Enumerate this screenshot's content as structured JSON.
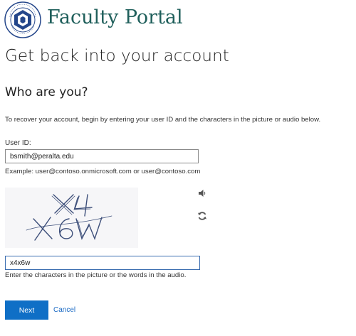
{
  "header": {
    "seal_text": "PERALTA COMMUNITY COLLEGE DISTRICT",
    "portal_title": "Faculty Portal"
  },
  "page": {
    "heading": "Get back into your account",
    "subheading": "Who are you?",
    "instructions": "To recover your account, begin by entering your user ID and the characters in the picture or audio below."
  },
  "form": {
    "userid_label": "User ID:",
    "userid_value": "bsmith@peralta.edu",
    "example_text": "Example: user@contoso.onmicrosoft.com or user@contoso.com",
    "captcha_image_text": "X4 X6W",
    "captcha_value": "x4x6w",
    "captcha_hint": "Enter the characters in the picture or the words in the audio."
  },
  "icons": {
    "audio": "speaker-icon",
    "refresh": "refresh-icon"
  },
  "actions": {
    "next_label": "Next",
    "cancel_label": "Cancel"
  },
  "colors": {
    "brand_teal": "#1f5f5b",
    "primary_button": "#0f6fc6",
    "link": "#1a6ac4",
    "seal_blue": "#24468a"
  }
}
